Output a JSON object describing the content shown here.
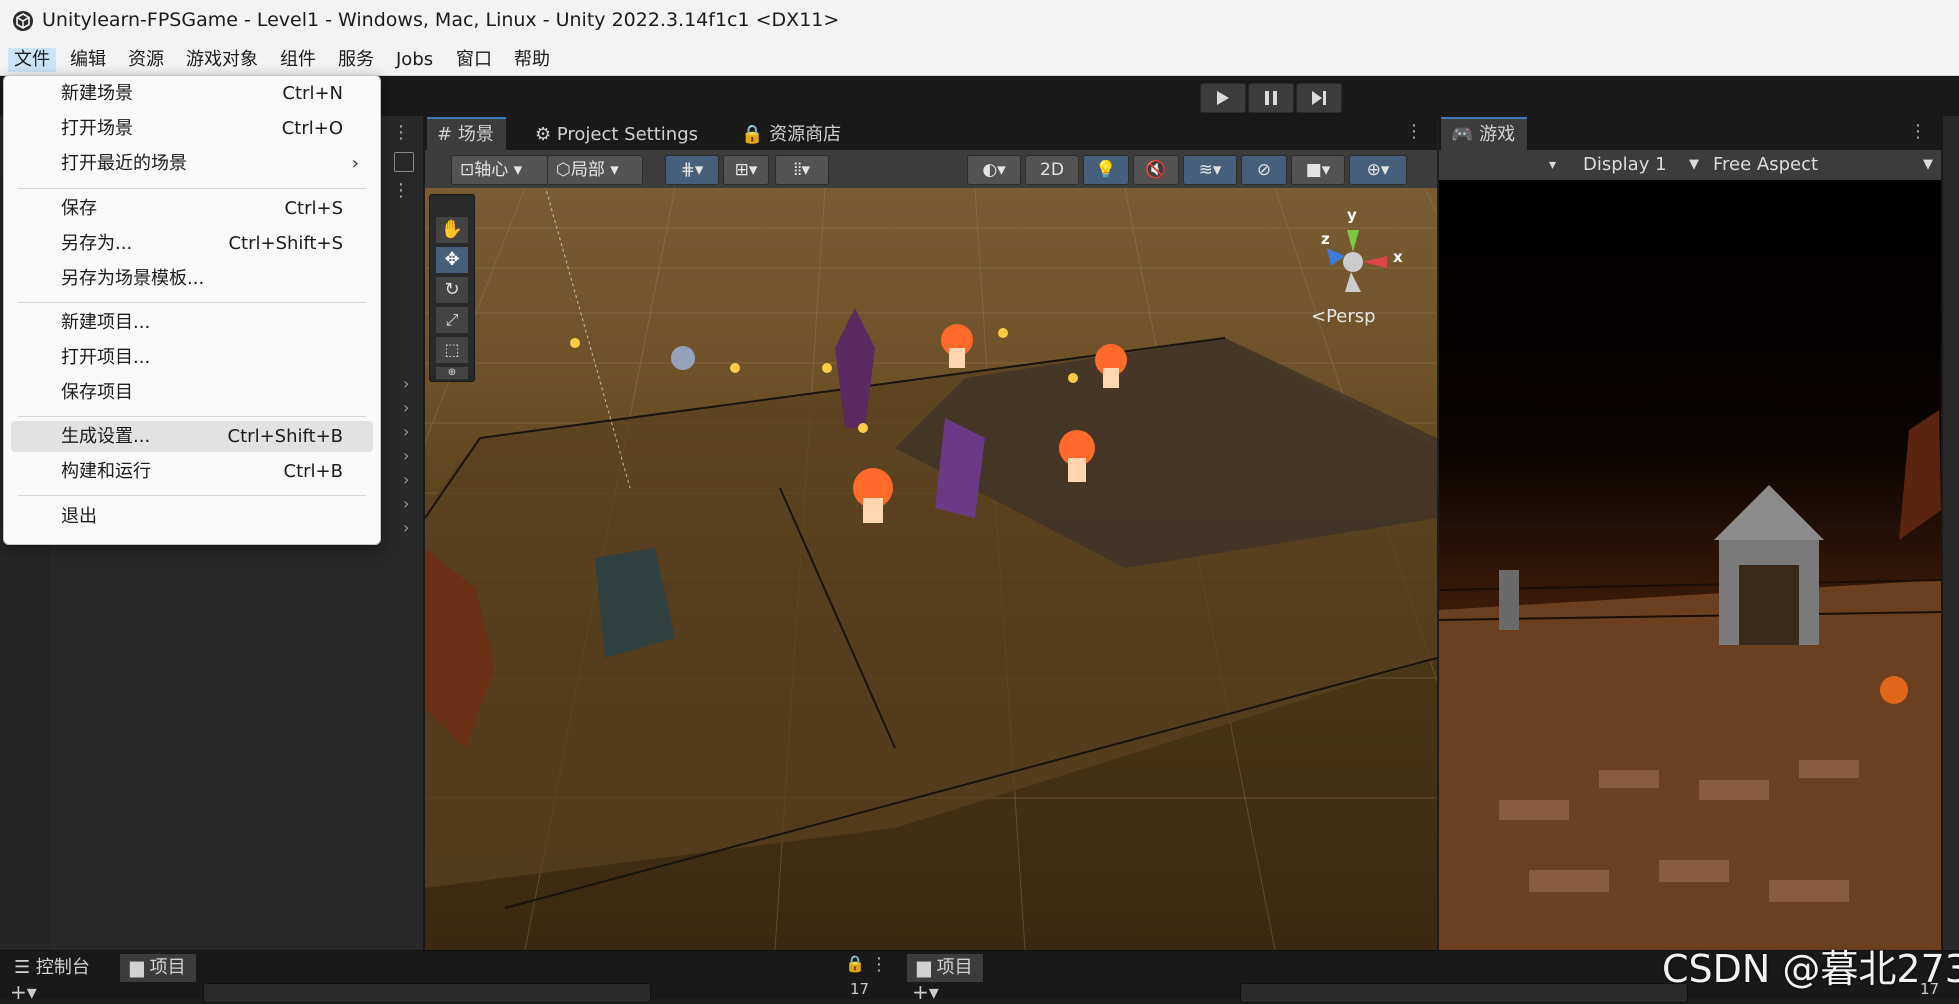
{
  "window": {
    "title": "Unitylearn-FPSGame - Level1 - Windows, Mac, Linux - Unity 2022.3.14f1c1 <DX11>"
  },
  "menubar": {
    "items": [
      "文件",
      "编辑",
      "资源",
      "游戏对象",
      "组件",
      "服务",
      "Jobs",
      "窗口",
      "帮助"
    ],
    "active": "文件"
  },
  "file_menu": {
    "items": [
      {
        "label": "新建场景",
        "shortcut": "Ctrl+N"
      },
      {
        "label": "打开场景",
        "shortcut": "Ctrl+O"
      },
      {
        "label": "打开最近的场景",
        "shortcut": "",
        "submenu": "›"
      },
      {
        "label": "保存",
        "shortcut": "Ctrl+S"
      },
      {
        "label": "另存为...",
        "shortcut": "Ctrl+Shift+S"
      },
      {
        "label": "另存为场景模板...",
        "shortcut": ""
      },
      {
        "label": "新建项目...",
        "shortcut": ""
      },
      {
        "label": "打开项目...",
        "shortcut": ""
      },
      {
        "label": "保存项目",
        "shortcut": ""
      },
      {
        "label": "生成设置...",
        "shortcut": "Ctrl+Shift+B",
        "highlighted": true
      },
      {
        "label": "构建和运行",
        "shortcut": "Ctrl+B"
      },
      {
        "label": "退出",
        "shortcut": ""
      }
    ]
  },
  "scene_panel": {
    "tabs": [
      {
        "label": "场景",
        "icon": "grid-icon",
        "active": true
      },
      {
        "label": "Project Settings",
        "icon": "gear-icon"
      },
      {
        "label": "资源商店",
        "icon": "store-bag-icon"
      }
    ],
    "toolbar": {
      "pivot": "轴心",
      "local": "局部",
      "mode_2d": "2D"
    },
    "gizmo": {
      "y": "y",
      "x": "x",
      "z": "z",
      "persp": "<Persp"
    }
  },
  "game_panel": {
    "tab": {
      "label": "游戏",
      "icon": "gamepad-icon"
    },
    "display": "Display 1",
    "aspect": "Free Aspect"
  },
  "bottom": {
    "left_tabs": [
      {
        "label": "控制台",
        "icon": "console-icon"
      },
      {
        "label": "项目",
        "icon": "folder-icon",
        "active": true
      }
    ],
    "right_tabs": [
      {
        "label": "项目",
        "icon": "folder-icon"
      }
    ],
    "counter_left": "17",
    "counter_right": "17"
  },
  "watermark": "CSDN @暮北273",
  "colors": {
    "accent": "#3a79bb",
    "menu_highlight": "#cce4f7",
    "editor_bg": "#282828"
  }
}
